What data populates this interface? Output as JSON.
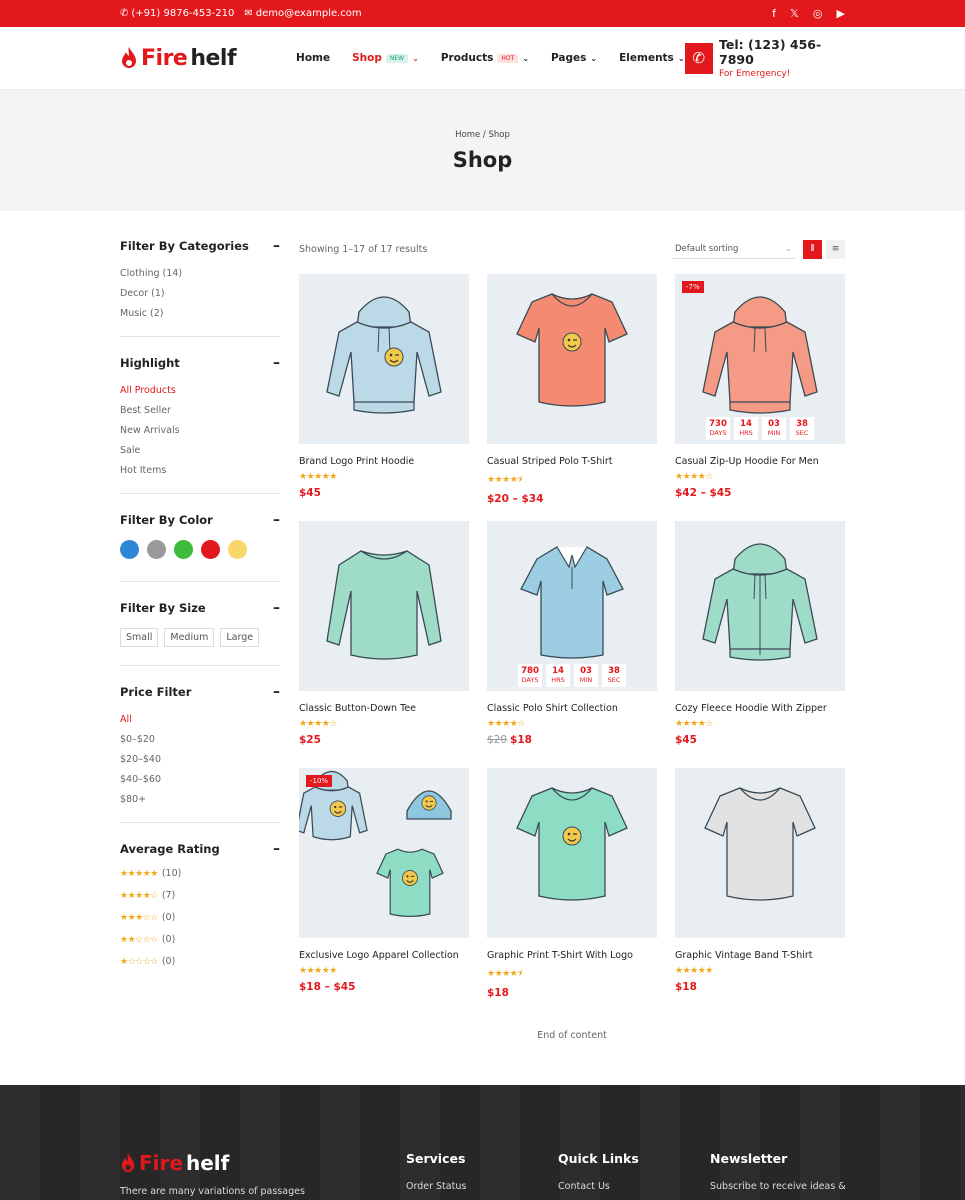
{
  "topbar": {
    "phone": "(+91) 9876-453-210",
    "email": "demo@example.com",
    "social": [
      "facebook-icon",
      "x-icon",
      "instagram-icon",
      "youtube-icon"
    ]
  },
  "brand": {
    "fire": "Fire",
    "helf": "helf"
  },
  "nav": [
    {
      "label": "Home",
      "badge": "",
      "chev": false
    },
    {
      "label": "Shop",
      "badge": "NEW",
      "chev": true
    },
    {
      "label": "Products",
      "badge": "HOT",
      "chev": true
    },
    {
      "label": "Pages",
      "badge": "",
      "chev": true
    },
    {
      "label": "Elements",
      "badge": "",
      "chev": true
    }
  ],
  "contact": {
    "tel": "Tel: (123) 456-7890",
    "emergency": "For Emergency!"
  },
  "hero": {
    "breadcrumb": "Home / Shop",
    "title": "Shop"
  },
  "sidebar": {
    "categories": {
      "title": "Filter By Categories",
      "items": [
        "Clothing (14)",
        "Decor (1)",
        "Music (2)"
      ]
    },
    "highlight": {
      "title": "Highlight",
      "items": [
        "All Products",
        "Best Seller",
        "New Arrivals",
        "Sale",
        "Hot Items"
      ]
    },
    "color": {
      "title": "Filter By Color",
      "swatches": [
        "#2e86d6",
        "#999999",
        "#3dbb3d",
        "#e3181c",
        "#f9d66a"
      ]
    },
    "size": {
      "title": "Filter By Size",
      "items": [
        "Small",
        "Medium",
        "Large"
      ]
    },
    "price": {
      "title": "Price Filter",
      "items": [
        "All",
        "$0–$20",
        "$20–$40",
        "$40–$60",
        "$80+"
      ]
    },
    "rating": {
      "title": "Average Rating",
      "items": [
        {
          "stars": "★★★★★",
          "count": "(10)"
        },
        {
          "stars": "★★★★☆",
          "count": "(7)"
        },
        {
          "stars": "★★★☆☆",
          "count": "(0)"
        },
        {
          "stars": "★★☆☆☆",
          "count": "(0)"
        },
        {
          "stars": "★☆☆☆☆",
          "count": "(0)"
        }
      ]
    }
  },
  "toolbar": {
    "results": "Showing 1–17 of 17 results",
    "sort": "Default sorting"
  },
  "products": [
    {
      "name": "Brand Logo Print Hoodie",
      "stars": "★★★★★",
      "price": "$45",
      "old": "",
      "sale": "",
      "timer": null,
      "kind": "hoodie",
      "color": "#bcd9e8"
    },
    {
      "name": "Casual Striped Polo T-Shirt",
      "stars": "★★★★⯨",
      "price": "$20 – $34",
      "old": "",
      "sale": "",
      "timer": null,
      "kind": "tee",
      "color": "#f58a72"
    },
    {
      "name": "Casual Zip-Up Hoodie For Men",
      "stars": "★★★★☆",
      "price": "$42 – $45",
      "old": "",
      "sale": "-7%",
      "timer": {
        "days": "730",
        "hrs": "14",
        "min": "03",
        "sec": "38"
      },
      "kind": "hoodie",
      "color": "#f59a84"
    },
    {
      "name": "Classic Button-Down Tee",
      "stars": "★★★★☆",
      "price": "$25",
      "old": "",
      "sale": "",
      "timer": null,
      "kind": "longsleeve",
      "color": "#9fdcc7"
    },
    {
      "name": "Classic Polo Shirt Collection",
      "stars": "★★★★☆",
      "price": "$18",
      "old": "$20",
      "sale": "",
      "timer": {
        "days": "780",
        "hrs": "14",
        "min": "03",
        "sec": "38"
      },
      "kind": "polo",
      "color": "#9ccde3"
    },
    {
      "name": "Cozy Fleece Hoodie With Zipper",
      "stars": "★★★★☆",
      "price": "$45",
      "old": "",
      "sale": "",
      "timer": null,
      "kind": "hoodie",
      "color": "#9fdcc7"
    },
    {
      "name": "Exclusive Logo Apparel Collection",
      "stars": "★★★★★",
      "price": "$18 – $45",
      "old": "",
      "sale": "-10%",
      "timer": null,
      "kind": "bundle",
      "color": "#bcd9e8"
    },
    {
      "name": "Graphic Print T-Shirt With Logo",
      "stars": "★★★★⯨",
      "price": "$18",
      "old": "",
      "sale": "",
      "timer": null,
      "kind": "tee",
      "color": "#8fdcc4"
    },
    {
      "name": "Graphic Vintage Band T-Shirt",
      "stars": "★★★★★",
      "price": "$18",
      "old": "",
      "sale": "",
      "timer": null,
      "kind": "tee",
      "color": "#e2e2e2"
    }
  ],
  "timer_units": {
    "days": "DAYS",
    "hrs": "HRS",
    "min": "MIN",
    "sec": "SEC"
  },
  "end_text": "End of content",
  "footer": {
    "about": "There are many variations of passages",
    "services": {
      "title": "Services",
      "first": "Order Status"
    },
    "quick": {
      "title": "Quick Links",
      "first": "Contact Us"
    },
    "newsletter": {
      "title": "Newsletter",
      "first": "Subscribe to receive ideas &"
    }
  },
  "colors": {
    "accent": "#e3181c",
    "star": "#f2a81d"
  }
}
